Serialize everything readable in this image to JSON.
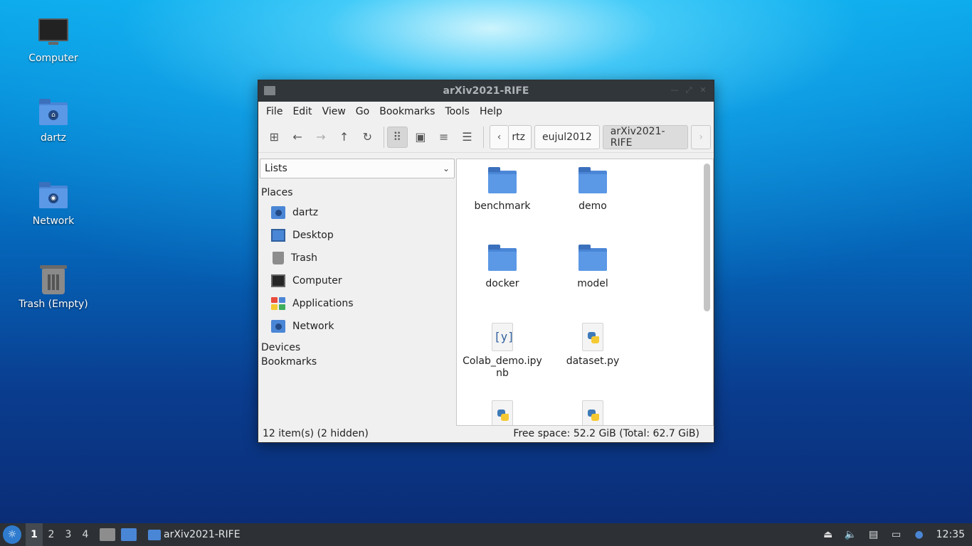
{
  "desktop": {
    "icons": [
      {
        "label": "Computer",
        "icon": "computer-icon"
      },
      {
        "label": "dartz",
        "icon": "home-folder-icon"
      },
      {
        "label": "Network",
        "icon": "network-folder-icon"
      },
      {
        "label": "Trash (Empty)",
        "icon": "trash-icon"
      }
    ]
  },
  "window": {
    "title": "arXiv2021-RIFE",
    "menu": [
      "File",
      "Edit",
      "View",
      "Go",
      "Bookmarks",
      "Tools",
      "Help"
    ],
    "toolbar": {
      "buttons": [
        "new-tab-icon",
        "back-icon",
        "forward-icon",
        "up-icon",
        "reload-icon",
        "icon-view-icon",
        "thumbnail-view-icon",
        "compact-view-icon",
        "detailed-view-icon"
      ]
    },
    "breadcrumbs": [
      "rtz",
      "eujul2012",
      "arXiv2021-RIFE"
    ],
    "side": {
      "selector": "Lists",
      "places_header": "Places",
      "places": [
        "dartz",
        "Desktop",
        "Trash",
        "Computer",
        "Applications",
        "Network"
      ],
      "devices_header": "Devices",
      "bookmarks_header": "Bookmarks"
    },
    "files": [
      {
        "name": "benchmark",
        "type": "folder"
      },
      {
        "name": "demo",
        "type": "folder"
      },
      {
        "name": "docker",
        "type": "folder"
      },
      {
        "name": "model",
        "type": "folder"
      },
      {
        "name": "Colab_demo.ipy\nnb",
        "type": "ipynb",
        "icon_text": "[y]"
      },
      {
        "name": "dataset.py",
        "type": "python"
      }
    ],
    "status": {
      "items": "12 item(s) (2 hidden)",
      "space": "Free space: 52.2 GiB (Total: 62.7 GiB)"
    }
  },
  "taskbar": {
    "workspaces": [
      "1",
      "2",
      "3",
      "4"
    ],
    "task": "arXiv2021-RIFE",
    "clock": "12:35"
  }
}
